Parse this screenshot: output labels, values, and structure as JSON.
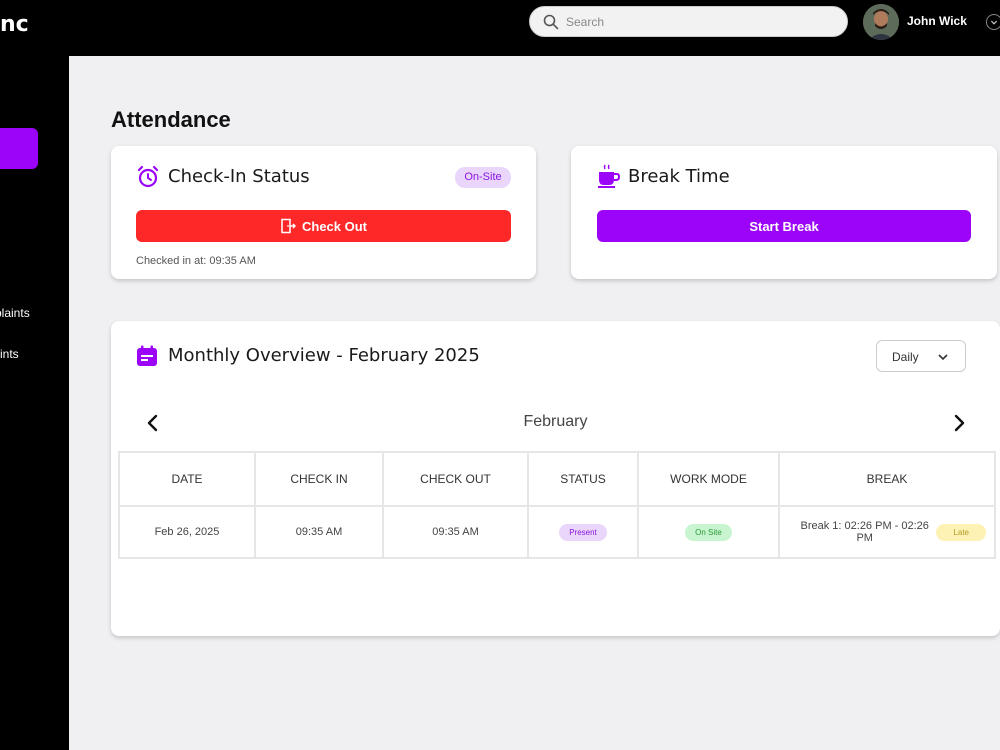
{
  "brand": "nc",
  "search": {
    "placeholder": "Search"
  },
  "user": {
    "name": "John Wick"
  },
  "sidebar": {
    "items": [
      {
        "label": "plaints"
      },
      {
        "label": "ints"
      }
    ]
  },
  "page": {
    "title": "Attendance"
  },
  "checkin": {
    "title": "Check-In Status",
    "badge": "On-Site",
    "button_label": "Check Out",
    "checked_in_text": "Checked in at: 09:35 AM"
  },
  "break_card": {
    "title": "Break Time",
    "button_label": "Start Break"
  },
  "overview": {
    "title": "Monthly Overview - February 2025",
    "view_select": "Daily",
    "month": "February",
    "columns": [
      "DATE",
      "CHECK IN",
      "CHECK OUT",
      "STATUS",
      "WORK MODE",
      "BREAK"
    ],
    "rows": [
      {
        "date": "Feb 26, 2025",
        "check_in": "09:35 AM",
        "check_out": "09:35 AM",
        "status": "Present",
        "work_mode": "On Site",
        "break_text": "Break 1: 02:26 PM - 02:26 PM",
        "break_badge": "Late"
      }
    ]
  },
  "colors": {
    "accent": "#9b04f9",
    "danger": "#ff2828",
    "topbar": "#000000",
    "page_bg": "#f0f0f3"
  }
}
